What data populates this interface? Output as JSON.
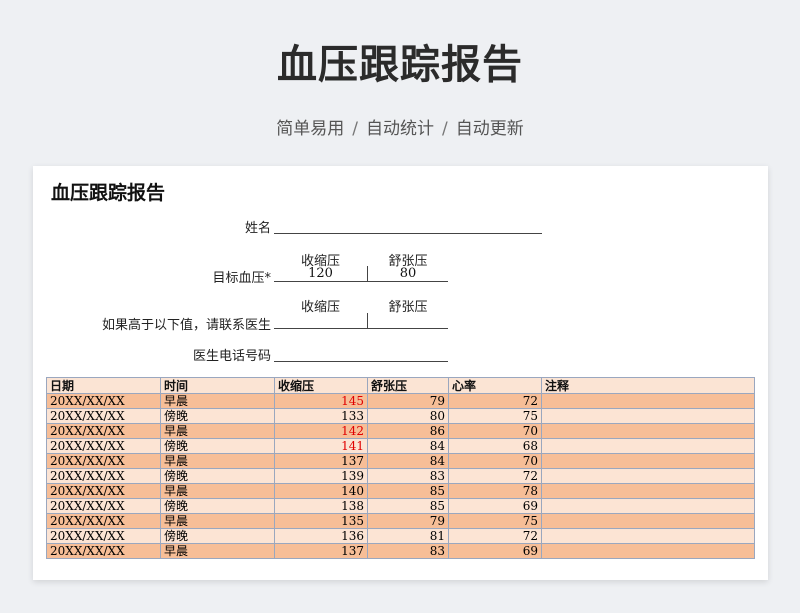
{
  "hero": {
    "title": "血压跟踪报告",
    "features": [
      "简单易用",
      "自动统计",
      "自动更新"
    ],
    "separator": "/"
  },
  "sheet": {
    "title": "血压跟踪报告",
    "name_label": "姓名",
    "target_label": "目标血压*",
    "systolic_caption": "收缩压",
    "diastolic_caption": "舒张压",
    "target_systolic": "120",
    "target_diastolic": "80",
    "contact_label": "如果高于以下值，请联系医生",
    "contact_systolic_caption": "收缩压",
    "contact_diastolic_caption": "舒张压",
    "doctor_phone_label": "医生电话号码"
  },
  "table": {
    "headers": [
      "日期",
      "时间",
      "收缩压",
      "舒张压",
      "心率",
      "注释"
    ],
    "rows": [
      {
        "date": "20XX/XX/XX",
        "time": "早晨",
        "systolic": "145",
        "diastolic": "79",
        "heart_rate": "72",
        "note": "",
        "high": true
      },
      {
        "date": "20XX/XX/XX",
        "time": "傍晚",
        "systolic": "133",
        "diastolic": "80",
        "heart_rate": "75",
        "note": "",
        "high": false
      },
      {
        "date": "20XX/XX/XX",
        "time": "早晨",
        "systolic": "142",
        "diastolic": "86",
        "heart_rate": "70",
        "note": "",
        "high": true
      },
      {
        "date": "20XX/XX/XX",
        "time": "傍晚",
        "systolic": "141",
        "diastolic": "84",
        "heart_rate": "68",
        "note": "",
        "high": true
      },
      {
        "date": "20XX/XX/XX",
        "time": "早晨",
        "systolic": "137",
        "diastolic": "84",
        "heart_rate": "70",
        "note": "",
        "high": false
      },
      {
        "date": "20XX/XX/XX",
        "time": "傍晚",
        "systolic": "139",
        "diastolic": "83",
        "heart_rate": "72",
        "note": "",
        "high": false
      },
      {
        "date": "20XX/XX/XX",
        "time": "早晨",
        "systolic": "140",
        "diastolic": "85",
        "heart_rate": "78",
        "note": "",
        "high": false
      },
      {
        "date": "20XX/XX/XX",
        "time": "傍晚",
        "systolic": "138",
        "diastolic": "85",
        "heart_rate": "69",
        "note": "",
        "high": false
      },
      {
        "date": "20XX/XX/XX",
        "time": "早晨",
        "systolic": "135",
        "diastolic": "79",
        "heart_rate": "75",
        "note": "",
        "high": false
      },
      {
        "date": "20XX/XX/XX",
        "time": "傍晚",
        "systolic": "136",
        "diastolic": "81",
        "heart_rate": "72",
        "note": "",
        "high": false
      },
      {
        "date": "20XX/XX/XX",
        "time": "早晨",
        "systolic": "137",
        "diastolic": "83",
        "heart_rate": "69",
        "note": "",
        "high": false
      }
    ]
  },
  "colors": {
    "high_value": "#e00000",
    "row_dark": "#f7be97",
    "row_light": "#fce4d4"
  }
}
